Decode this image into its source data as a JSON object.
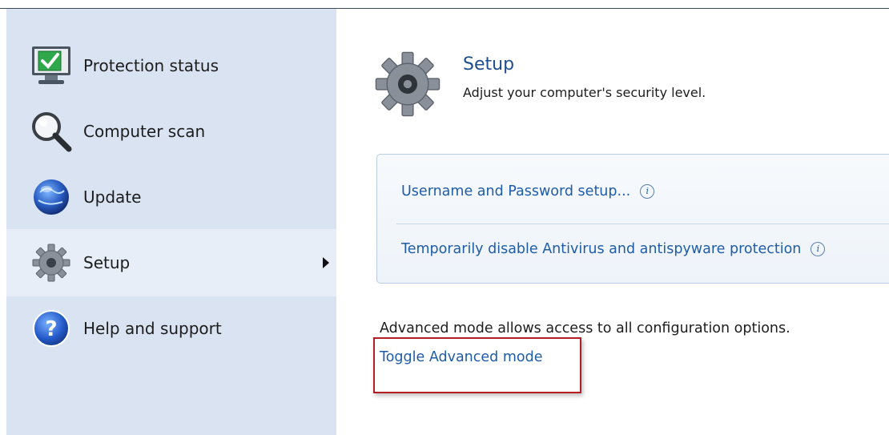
{
  "sidebar": {
    "items": [
      {
        "label": "Protection status",
        "icon": "monitor-check-icon"
      },
      {
        "label": "Computer scan",
        "icon": "magnifier-icon"
      },
      {
        "label": "Update",
        "icon": "globe-icon"
      },
      {
        "label": "Setup",
        "icon": "gear-icon",
        "active": true
      },
      {
        "label": "Help and support",
        "icon": "help-icon"
      }
    ]
  },
  "main": {
    "title": "Setup",
    "subtitle": "Adjust your computer's security level.",
    "options": [
      {
        "label": "Username and Password setup..."
      },
      {
        "label": "Temporarily disable Antivirus and antispyware protection"
      }
    ],
    "advanced_text": "Advanced mode allows access to all configuration options.",
    "toggle_label": "Toggle Advanced mode"
  },
  "colors": {
    "sidebar_bg": "#d9e3f1",
    "active_bg": "#e8eef7",
    "link": "#1f5ca8",
    "highlight": "#b51e24"
  }
}
